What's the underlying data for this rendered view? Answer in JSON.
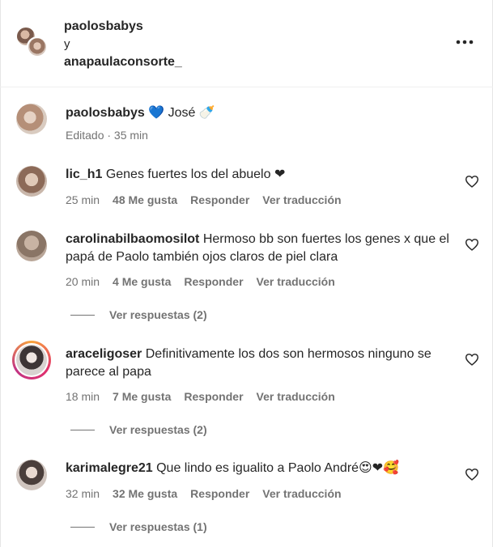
{
  "header": {
    "user1": "paolosbabys",
    "conj": "y",
    "user2": "anapaulaconsorte_",
    "more": "•••"
  },
  "caption": {
    "username": "paolosbabys",
    "text": "💙 José 🍼",
    "meta": "Editado · 35 min"
  },
  "comments": [
    {
      "username": "lic_h1",
      "text": "Genes fuertes los del abuelo ❤",
      "time": "25 min",
      "likes": "48 Me gusta",
      "reply": "Responder",
      "translate": "Ver traducción"
    },
    {
      "username": "carolinabilbaomosilot",
      "text": "Hermoso bb son fuertes los genes x que el papá de Paolo también ojos claros de piel clara",
      "time": "20 min",
      "likes": "4 Me gusta",
      "reply": "Responder",
      "translate": "Ver traducción",
      "replies": "Ver respuestas (2)"
    },
    {
      "username": "araceligoser",
      "text": "Definitivamente los dos son hermosos ninguno se parece al papa",
      "time": "18 min",
      "likes": "7 Me gusta",
      "reply": "Responder",
      "translate": "Ver traducción",
      "replies": "Ver respuestas (2)"
    },
    {
      "username": "karimalegre21",
      "text": "Que lindo es igualito a Paolo André😍❤🥰",
      "time": "32 min",
      "likes": "32 Me gusta",
      "reply": "Responder",
      "translate": "Ver traducción",
      "replies": "Ver respuestas (1)"
    }
  ]
}
